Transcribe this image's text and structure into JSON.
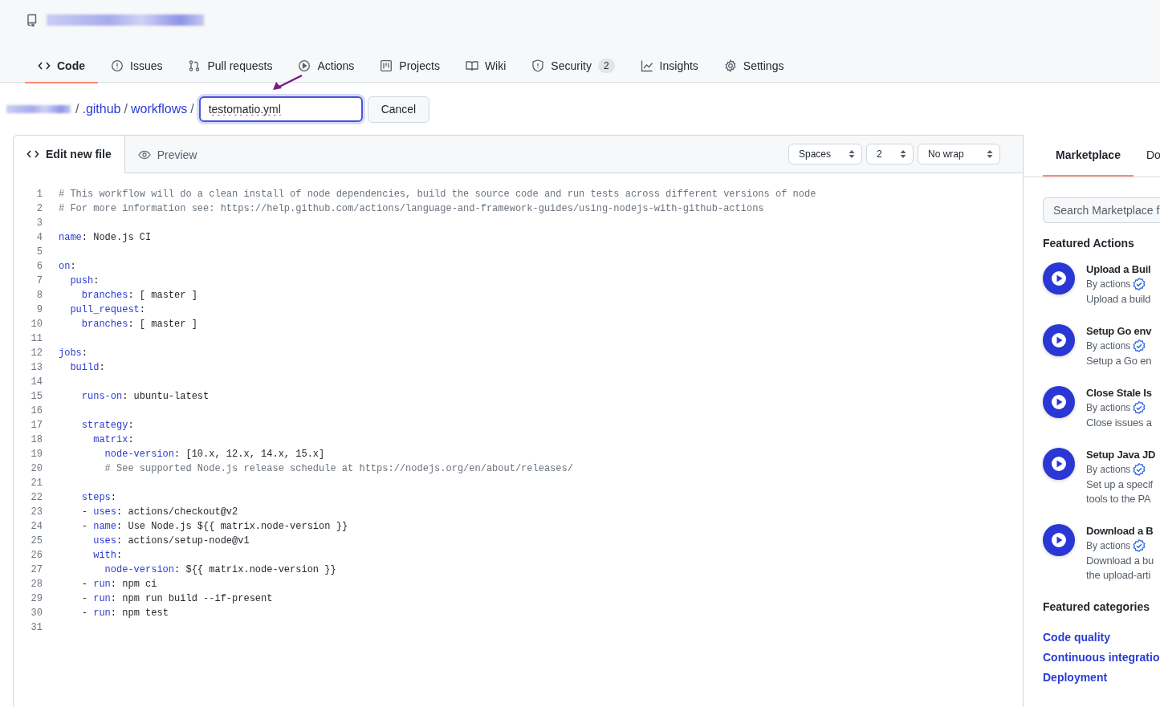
{
  "nav": {
    "tabs": [
      {
        "label": "Code",
        "selected": true
      },
      {
        "label": "Issues",
        "selected": false
      },
      {
        "label": "Pull requests",
        "selected": false
      },
      {
        "label": "Actions",
        "selected": false
      },
      {
        "label": "Projects",
        "selected": false
      },
      {
        "label": "Wiki",
        "selected": false
      },
      {
        "label": "Security",
        "selected": false,
        "count": "2"
      },
      {
        "label": "Insights",
        "selected": false
      },
      {
        "label": "Settings",
        "selected": false
      }
    ]
  },
  "breadcrumb": {
    "links": [
      ".github",
      "workflows"
    ],
    "separator": "/",
    "filename": "testomatio.yml",
    "cancel": "Cancel"
  },
  "editor": {
    "tabs": [
      {
        "label": "Edit new file",
        "selected": true
      },
      {
        "label": "Preview",
        "selected": false
      }
    ],
    "selects": [
      "Spaces",
      "2",
      "No wrap"
    ],
    "lines": [
      {
        "number": "1",
        "segments": [
          {
            "kind": "comment",
            "text": "# This workflow will do a clean install of node dependencies, build the source code and run tests across different versions of node"
          }
        ]
      },
      {
        "number": "2",
        "segments": [
          {
            "kind": "comment",
            "text": "# For more information see: https://help.github.com/actions/language-and-framework-guides/using-nodejs-with-github-actions"
          }
        ]
      },
      {
        "number": "3"
      },
      {
        "number": "4",
        "segments": [
          {
            "kind": "key",
            "text": "name"
          },
          {
            "kind": "plain",
            "text": ": Node.js CI"
          }
        ]
      },
      {
        "number": "5"
      },
      {
        "number": "6",
        "segments": [
          {
            "kind": "key",
            "text": "on"
          },
          {
            "kind": "plain",
            "text": ":"
          }
        ]
      },
      {
        "number": "7",
        "segments": [
          {
            "kind": "key",
            "text": "  push"
          },
          {
            "kind": "plain",
            "text": ":"
          }
        ]
      },
      {
        "number": "8",
        "segments": [
          {
            "kind": "key",
            "text": "    branches"
          },
          {
            "kind": "plain",
            "text": ": [ master ]"
          }
        ]
      },
      {
        "number": "9",
        "segments": [
          {
            "kind": "key",
            "text": "  pull_request"
          },
          {
            "kind": "plain",
            "text": ":"
          }
        ]
      },
      {
        "number": "10",
        "segments": [
          {
            "kind": "key",
            "text": "    branches"
          },
          {
            "kind": "plain",
            "text": ": [ master ]"
          }
        ]
      },
      {
        "number": "11"
      },
      {
        "number": "12",
        "segments": [
          {
            "kind": "key",
            "text": "jobs"
          },
          {
            "kind": "plain",
            "text": ":"
          }
        ]
      },
      {
        "number": "13",
        "segments": [
          {
            "kind": "key",
            "text": "  build"
          },
          {
            "kind": "plain",
            "text": ":"
          }
        ]
      },
      {
        "number": "14"
      },
      {
        "number": "15",
        "segments": [
          {
            "kind": "key",
            "text": "    runs-on"
          },
          {
            "kind": "plain",
            "text": ": ubuntu-latest"
          }
        ]
      },
      {
        "number": "16"
      },
      {
        "number": "17",
        "segments": [
          {
            "kind": "key",
            "text": "    strategy"
          },
          {
            "kind": "plain",
            "text": ":"
          }
        ]
      },
      {
        "number": "18",
        "segments": [
          {
            "kind": "key",
            "text": "      matrix"
          },
          {
            "kind": "plain",
            "text": ":"
          }
        ]
      },
      {
        "number": "19",
        "segments": [
          {
            "kind": "key",
            "text": "        node-version"
          },
          {
            "kind": "plain",
            "text": ": [10.x, 12.x, 14.x, 15.x]"
          }
        ]
      },
      {
        "number": "20",
        "segments": [
          {
            "kind": "comment",
            "text": "        # See supported Node.js release schedule at https://nodejs.org/en/about/releases/"
          }
        ]
      },
      {
        "number": "21"
      },
      {
        "number": "22",
        "segments": [
          {
            "kind": "key",
            "text": "    steps"
          },
          {
            "kind": "plain",
            "text": ":"
          }
        ]
      },
      {
        "number": "23",
        "segments": [
          {
            "kind": "plain",
            "text": "    - "
          },
          {
            "kind": "key",
            "text": "uses"
          },
          {
            "kind": "plain",
            "text": ": actions/checkout@v2"
          }
        ]
      },
      {
        "number": "24",
        "segments": [
          {
            "kind": "plain",
            "text": "    - "
          },
          {
            "kind": "key",
            "text": "name"
          },
          {
            "kind": "plain",
            "text": ": Use Node.js ${{ matrix.node-version }}"
          }
        ]
      },
      {
        "number": "25",
        "segments": [
          {
            "kind": "key",
            "text": "      uses"
          },
          {
            "kind": "plain",
            "text": ": actions/setup-node@v1"
          }
        ]
      },
      {
        "number": "26",
        "segments": [
          {
            "kind": "key",
            "text": "      with"
          },
          {
            "kind": "plain",
            "text": ":"
          }
        ]
      },
      {
        "number": "27",
        "segments": [
          {
            "kind": "key",
            "text": "        node-version"
          },
          {
            "kind": "plain",
            "text": ": ${{ matrix.node-version }}"
          }
        ]
      },
      {
        "number": "28",
        "segments": [
          {
            "kind": "plain",
            "text": "    - "
          },
          {
            "kind": "key",
            "text": "run"
          },
          {
            "kind": "plain",
            "text": ": npm ci"
          }
        ]
      },
      {
        "number": "29",
        "segments": [
          {
            "kind": "plain",
            "text": "    - "
          },
          {
            "kind": "key",
            "text": "run"
          },
          {
            "kind": "plain",
            "text": ": npm run build --if-present"
          }
        ]
      },
      {
        "number": "30",
        "segments": [
          {
            "kind": "plain",
            "text": "    - "
          },
          {
            "kind": "key",
            "text": "run"
          },
          {
            "kind": "plain",
            "text": ": npm test"
          }
        ]
      },
      {
        "number": "31"
      }
    ]
  },
  "sidebar": {
    "tabs": [
      {
        "label": "Marketplace",
        "selected": true
      },
      {
        "label": "Do",
        "selected": false
      }
    ],
    "search": {
      "placeholder": "Search Marketplace f"
    },
    "featured_title": "Featured Actions",
    "actions": [
      {
        "title": "Upload a Buil",
        "author": "By actions",
        "description": [
          "Upload a build"
        ]
      },
      {
        "title": "Setup Go env",
        "author": "By actions",
        "description": [
          "Setup a Go en"
        ]
      },
      {
        "title": "Close Stale Is",
        "author": "By actions",
        "description": [
          "Close issues a"
        ]
      },
      {
        "title": "Setup Java JD",
        "author": "By actions",
        "description": [
          "Set up a specif",
          "tools to the PA"
        ]
      },
      {
        "title": "Download a B",
        "author": "By actions",
        "description": [
          "Download a bu",
          "the upload-arti"
        ]
      }
    ],
    "categories_title": "Featured categories",
    "categories": [
      "Code quality",
      "Continuous integratio",
      "Deployment"
    ]
  }
}
